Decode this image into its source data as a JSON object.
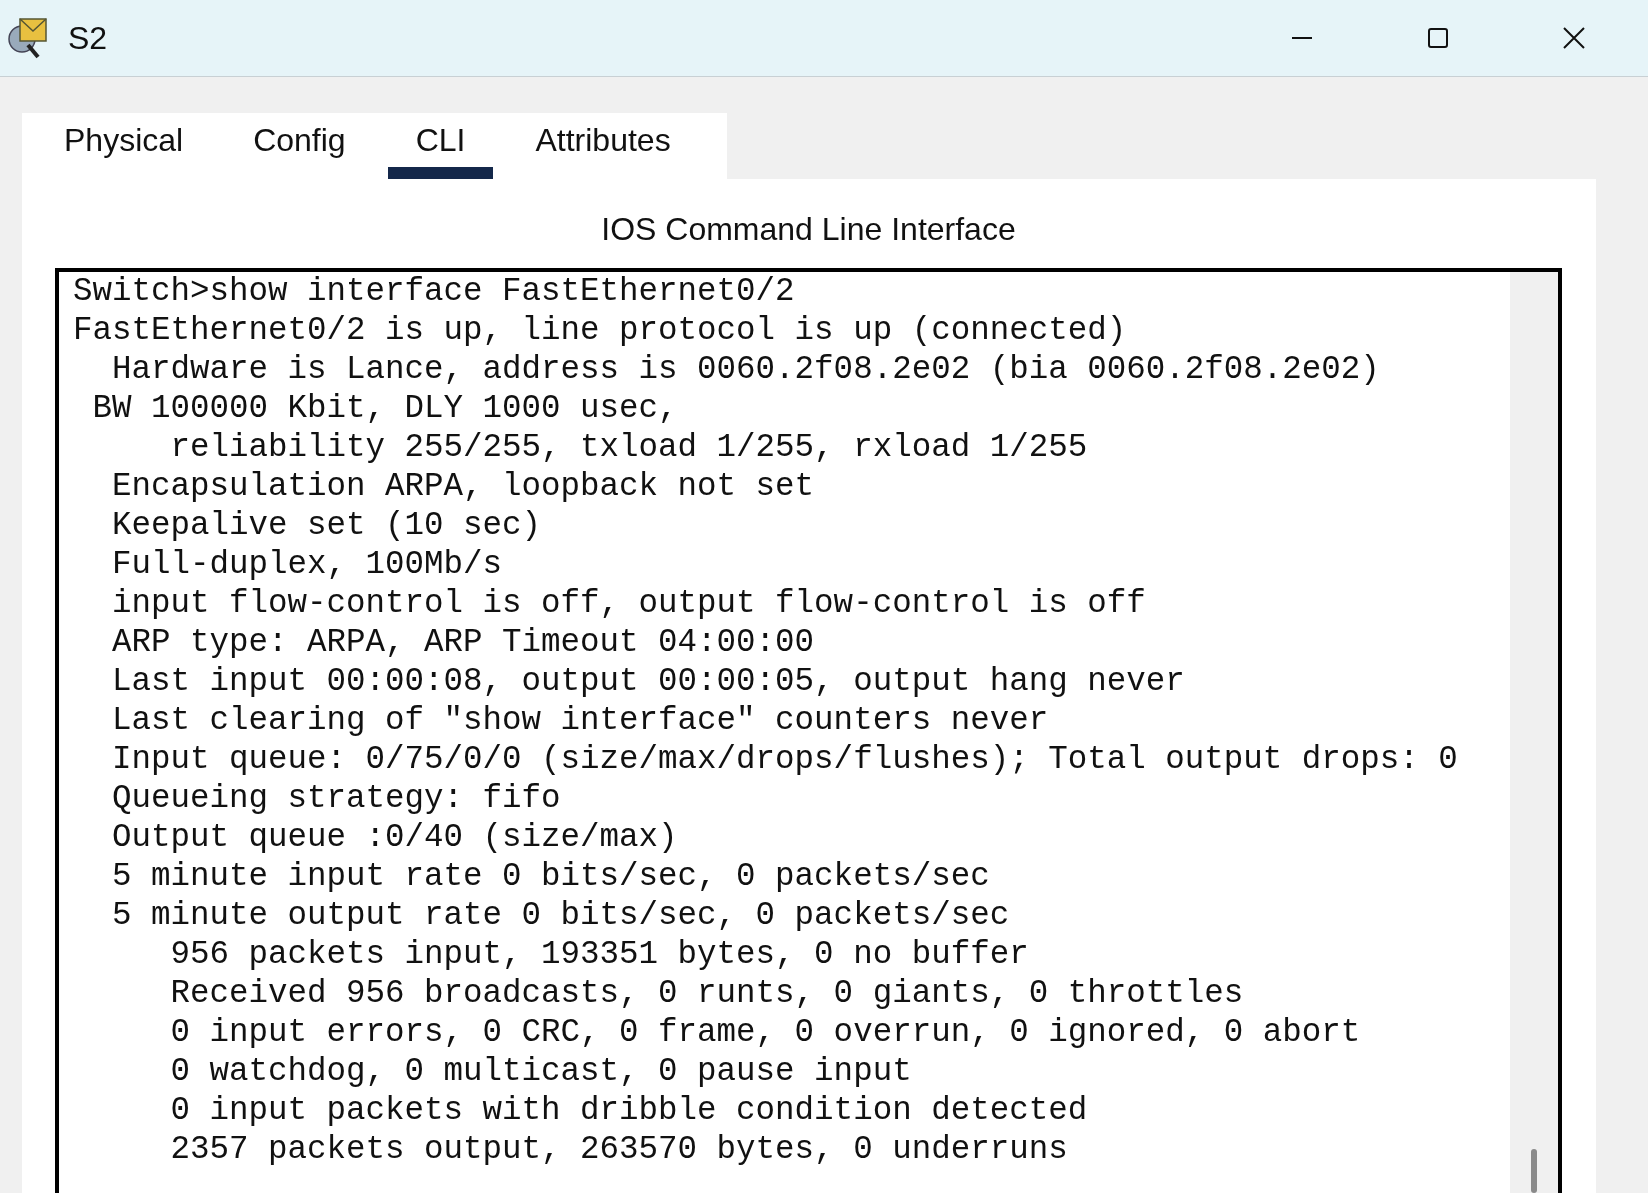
{
  "window": {
    "title": "S2"
  },
  "tabs": [
    {
      "label": "Physical",
      "selected": false
    },
    {
      "label": "Config",
      "selected": false
    },
    {
      "label": "CLI",
      "selected": true
    },
    {
      "label": "Attributes",
      "selected": false
    }
  ],
  "panel_title": "IOS Command Line Interface",
  "console_lines": [
    "Switch>show interface FastEthernet0/2",
    "FastEthernet0/2 is up, line protocol is up (connected)",
    "  Hardware is Lance, address is 0060.2f08.2e02 (bia 0060.2f08.2e02)",
    " BW 100000 Kbit, DLY 1000 usec,",
    "     reliability 255/255, txload 1/255, rxload 1/255",
    "  Encapsulation ARPA, loopback not set",
    "  Keepalive set (10 sec)",
    "  Full-duplex, 100Mb/s",
    "  input flow-control is off, output flow-control is off",
    "  ARP type: ARPA, ARP Timeout 04:00:00",
    "  Last input 00:00:08, output 00:00:05, output hang never",
    "  Last clearing of \"show interface\" counters never",
    "  Input queue: 0/75/0/0 (size/max/drops/flushes); Total output drops: 0",
    "  Queueing strategy: fifo",
    "  Output queue :0/40 (size/max)",
    "  5 minute input rate 0 bits/sec, 0 packets/sec",
    "  5 minute output rate 0 bits/sec, 0 packets/sec",
    "     956 packets input, 193351 bytes, 0 no buffer",
    "     Received 956 broadcasts, 0 runts, 0 giants, 0 throttles",
    "     0 input errors, 0 CRC, 0 frame, 0 overrun, 0 ignored, 0 abort",
    "     0 watchdog, 0 multicast, 0 pause input",
    "     0 input packets with dribble condition detected",
    "     2357 packets output, 263570 bytes, 0 underruns"
  ]
}
